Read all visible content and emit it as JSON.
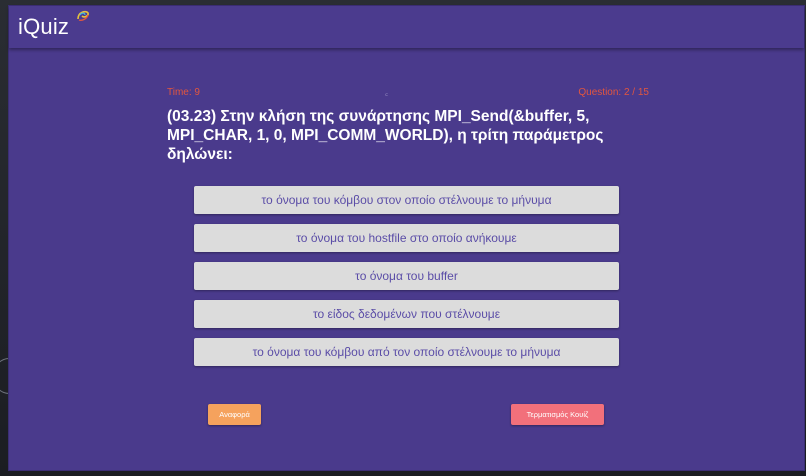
{
  "app": {
    "logo": "iQuiz"
  },
  "status": {
    "time": "Time: 9",
    "question_progress": "Question: 2 / 15"
  },
  "question": {
    "text": "(03.23) Στην κλήση της συνάρτησης MPI_Send(&buffer, 5, MPI_CHAR, 1, 0, MPI_COMM_WORLD), η τρίτη παράμετρος δηλώνει:"
  },
  "answers": [
    "το όνομα του κόμβου στον οποίο στέλνουμε το μήνυμα",
    "το όνομα του hostfile στο οποίο ανήκουμε",
    "το όνομα του buffer",
    "το είδος δεδομένων που στέλνουμε",
    "το όνομα του κόμβου από τον οποίο στέλνουμε το μήνυμα"
  ],
  "actions": {
    "report": "Αναφορά",
    "end_quiz": "Τερματισμός Κουίζ"
  },
  "colors": {
    "background": "#4a3a8c",
    "status_text": "#e2563f",
    "answer_bg": "#dcdcdc",
    "answer_text": "#5b4da7",
    "report_button": "#f5a25d",
    "end_button": "#f2707b"
  },
  "icons": {
    "logo_mark": "swirl-logo-icon"
  }
}
